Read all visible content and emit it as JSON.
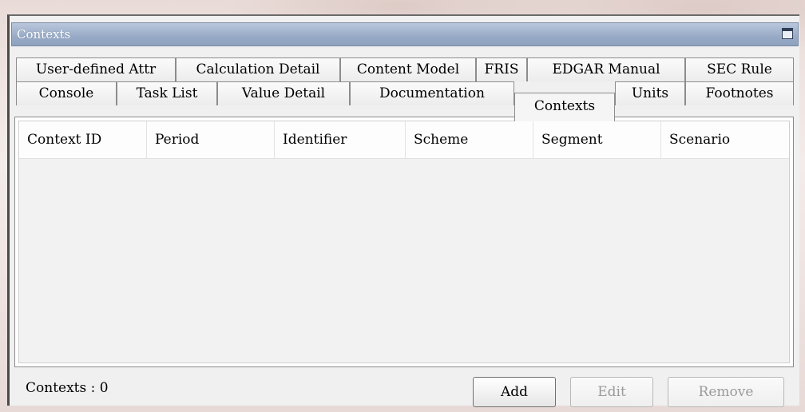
{
  "panel": {
    "title": "Contexts"
  },
  "tabs_row1": [
    {
      "label": "User-defined Attr"
    },
    {
      "label": "Calculation Detail"
    },
    {
      "label": "Content Model"
    },
    {
      "label": "FRIS"
    },
    {
      "label": "EDGAR Manual"
    },
    {
      "label": "SEC Rule"
    }
  ],
  "tabs_row2": [
    {
      "label": "Console"
    },
    {
      "label": "Task List"
    },
    {
      "label": "Value Detail"
    },
    {
      "label": "Documentation"
    },
    {
      "label": "Contexts",
      "active": true
    },
    {
      "label": "Units"
    },
    {
      "label": "Footnotes"
    }
  ],
  "table": {
    "columns": [
      "Context ID",
      "Period",
      "Identifier",
      "Scheme",
      "Segment",
      "Scenario"
    ],
    "rows": []
  },
  "footer": {
    "count_label": "Contexts : 0",
    "add_label": "Add",
    "edit_label": "Edit",
    "remove_label": "Remove"
  }
}
